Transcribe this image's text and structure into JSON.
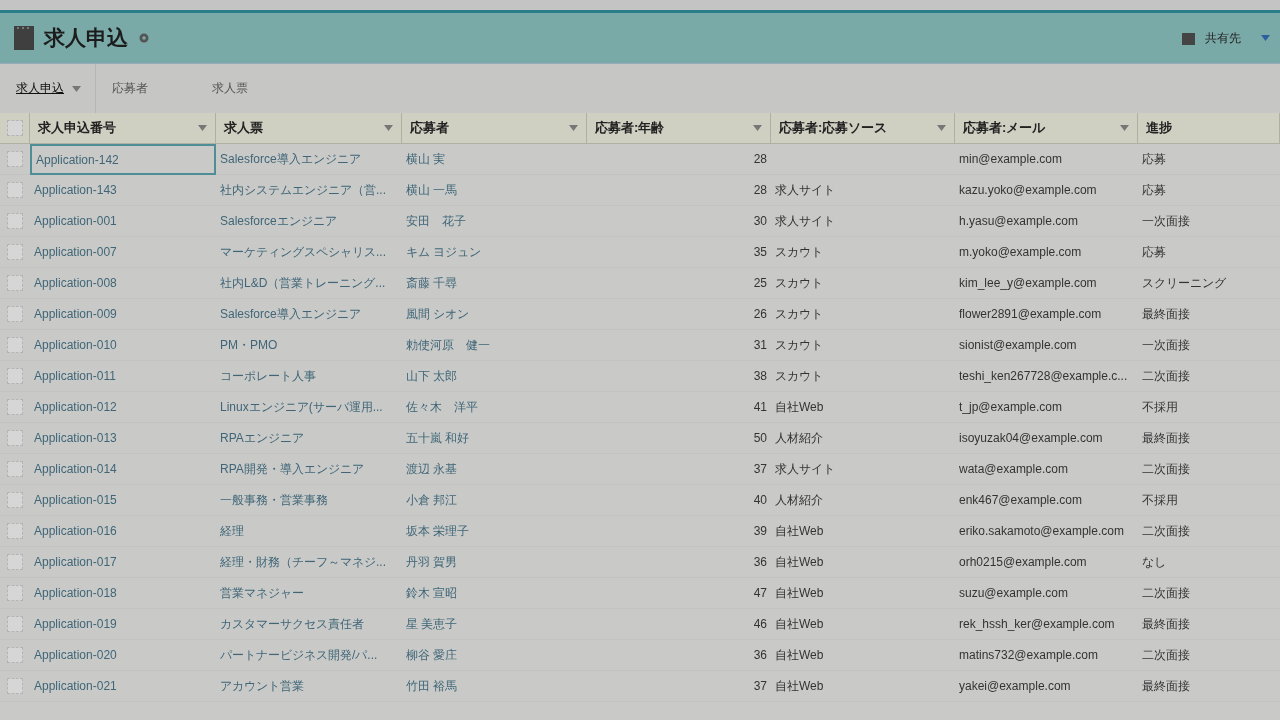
{
  "header": {
    "title": "求人申込",
    "share_label": "共有先"
  },
  "tabs": [
    {
      "label": "求人申込",
      "selected": true,
      "has_menu": true
    },
    {
      "label": "応募者",
      "selected": false,
      "has_menu": false
    },
    {
      "label": "求人票",
      "selected": false,
      "has_menu": false
    }
  ],
  "table": {
    "all_checked": false,
    "columns": [
      {
        "label": "求人申込番号",
        "filter": true
      },
      {
        "label": "求人票",
        "filter": true
      },
      {
        "label": "応募者",
        "filter": true
      },
      {
        "label": "応募者:年齢",
        "filter": true
      },
      {
        "label": "応募者:応募ソース",
        "filter": true
      },
      {
        "label": "応募者:メール",
        "filter": true
      },
      {
        "label": "進捗",
        "filter": false
      }
    ],
    "rows": [
      {
        "selected": true,
        "checked": false,
        "cells": [
          "Application-142",
          "Salesforce導入エンジニア",
          "横山 実",
          "28",
          "",
          "min@example.com",
          "応募"
        ]
      },
      {
        "selected": false,
        "checked": false,
        "cells": [
          "Application-143",
          "社内システムエンジニア（営...",
          "横山 一馬",
          "28",
          "求人サイト",
          "kazu.yoko@example.com",
          "応募"
        ]
      },
      {
        "selected": false,
        "checked": false,
        "cells": [
          "Application-001",
          "Salesforceエンジニア",
          "安田　花子",
          "30",
          "求人サイト",
          "h.yasu@example.com",
          "一次面接"
        ]
      },
      {
        "selected": false,
        "checked": false,
        "cells": [
          "Application-007",
          "マーケティングスペシャリス...",
          "キム ヨジュン",
          "35",
          "スカウト",
          "m.yoko@example.com",
          "応募"
        ]
      },
      {
        "selected": false,
        "checked": false,
        "cells": [
          "Application-008",
          "社内L&D（営業トレーニング...",
          "斎藤 千尋",
          "25",
          "スカウト",
          "kim_lee_y@example.com",
          "スクリーニング"
        ]
      },
      {
        "selected": false,
        "checked": false,
        "cells": [
          "Application-009",
          "Salesforce導入エンジニア",
          "風間 シオン",
          "26",
          "スカウト",
          "flower2891@example.com",
          "最終面接"
        ]
      },
      {
        "selected": false,
        "checked": false,
        "cells": [
          "Application-010",
          "PM・PMO",
          "勅使河原　健一",
          "31",
          "スカウト",
          "sionist@example.com",
          "一次面接"
        ]
      },
      {
        "selected": false,
        "checked": false,
        "cells": [
          "Application-011",
          "コーポレート人事",
          "山下 太郎",
          "38",
          "スカウト",
          "teshi_ken267728@example.c...",
          "二次面接"
        ]
      },
      {
        "selected": false,
        "checked": false,
        "cells": [
          "Application-012",
          "Linuxエンジニア(サーバ運用...",
          "佐々木　洋平",
          "41",
          "自社Web",
          "t_jp@example.com",
          "不採用"
        ]
      },
      {
        "selected": false,
        "checked": false,
        "cells": [
          "Application-013",
          "RPAエンジニア",
          "五十嵐 和好",
          "50",
          "人材紹介",
          "isoyuzak04@example.com",
          "最終面接"
        ]
      },
      {
        "selected": false,
        "checked": false,
        "cells": [
          "Application-014",
          "RPA開発・導入エンジニア",
          "渡辺 永基",
          "37",
          "求人サイト",
          "wata@example.com",
          "二次面接"
        ]
      },
      {
        "selected": false,
        "checked": false,
        "cells": [
          "Application-015",
          "一般事務・営業事務",
          "小倉 邦江",
          "40",
          "人材紹介",
          "enk467@example.com",
          "不採用"
        ]
      },
      {
        "selected": false,
        "checked": false,
        "cells": [
          "Application-016",
          "経理",
          "坂本 栄理子",
          "39",
          "自社Web",
          "eriko.sakamoto@example.com",
          "二次面接"
        ]
      },
      {
        "selected": false,
        "checked": false,
        "cells": [
          "Application-017",
          "経理・財務（チーフ～マネジ...",
          "丹羽 賀男",
          "36",
          "自社Web",
          "orh0215@example.com",
          "なし"
        ]
      },
      {
        "selected": false,
        "checked": false,
        "cells": [
          "Application-018",
          "営業マネジャー",
          "鈴木 宣昭",
          "47",
          "自社Web",
          "suzu@example.com",
          "二次面接"
        ]
      },
      {
        "selected": false,
        "checked": false,
        "cells": [
          "Application-019",
          "カスタマーサクセス責任者",
          "星 美恵子",
          "46",
          "自社Web",
          "rek_hssh_ker@example.com",
          "最終面接"
        ]
      },
      {
        "selected": false,
        "checked": false,
        "cells": [
          "Application-020",
          "パートナービジネス開発/パ...",
          "柳谷 愛庄",
          "36",
          "自社Web",
          "matins732@example.com",
          "二次面接"
        ]
      },
      {
        "selected": false,
        "checked": false,
        "cells": [
          "Application-021",
          "アカウント営業",
          "竹田 裕馬",
          "37",
          "自社Web",
          "yakei@example.com",
          "最終面接"
        ]
      }
    ]
  }
}
